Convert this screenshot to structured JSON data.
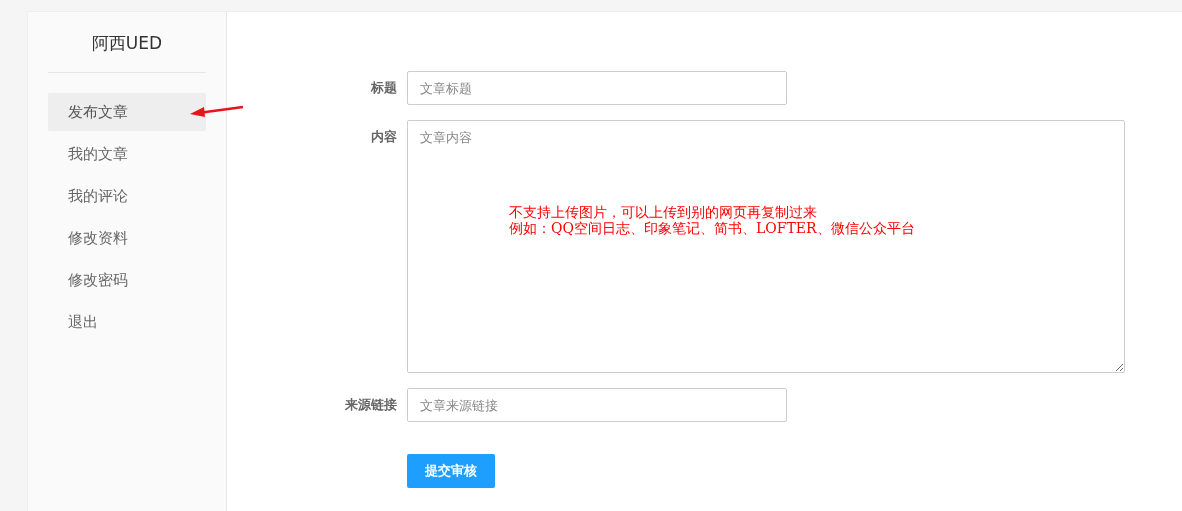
{
  "sidebar": {
    "title": "阿西UED",
    "items": [
      {
        "label": "发布文章",
        "selected": true
      },
      {
        "label": "我的文章",
        "selected": false
      },
      {
        "label": "我的评论",
        "selected": false
      },
      {
        "label": "修改资料",
        "selected": false
      },
      {
        "label": "修改密码",
        "selected": false
      },
      {
        "label": "退出",
        "selected": false
      }
    ]
  },
  "form": {
    "fields": [
      {
        "kind": "input",
        "label": "标题",
        "placeholder": "文章标题"
      },
      {
        "kind": "textarea",
        "label": "内容",
        "placeholder": "文章内容",
        "note": [
          "不支持上传图片，可以上传到别的网页再复制过来",
          "例如：QQ空间日志、印象笔记、简书、LOFTER、微信公众平台"
        ]
      },
      {
        "kind": "input",
        "label": "来源链接",
        "placeholder": "文章来源链接"
      }
    ],
    "submit": "提交审核"
  }
}
